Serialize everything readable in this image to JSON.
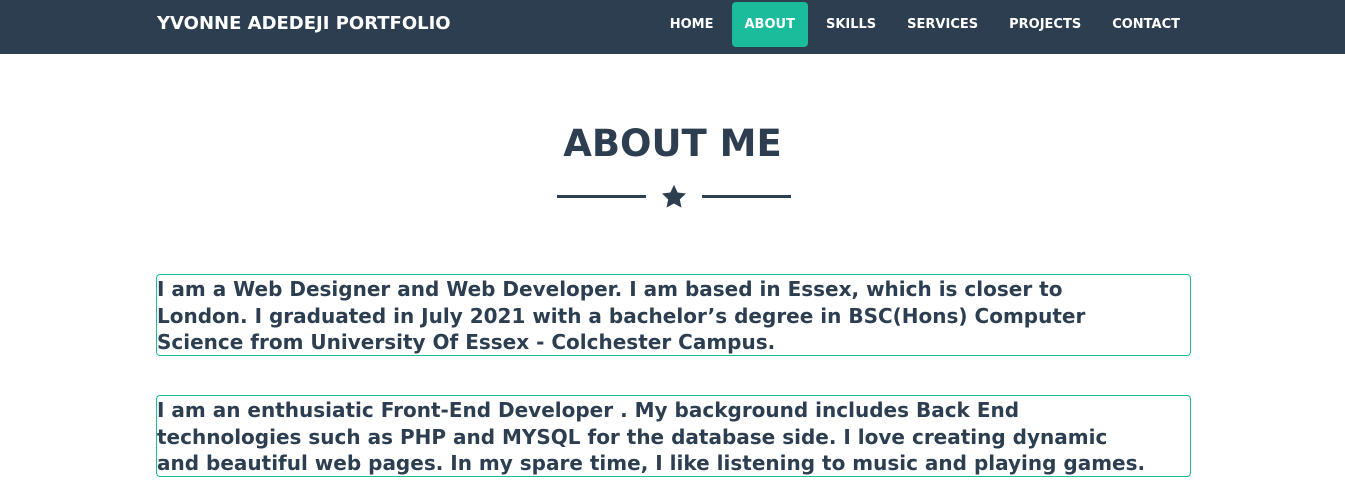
{
  "header": {
    "brand": "YVONNE ADEDEJI PORTFOLIO",
    "nav": [
      {
        "label": "HOME"
      },
      {
        "label": "ABOUT"
      },
      {
        "label": "SKILLS"
      },
      {
        "label": "SERVICES"
      },
      {
        "label": "PROJECTS"
      },
      {
        "label": "CONTACT"
      }
    ],
    "active_nav": "ABOUT"
  },
  "about": {
    "title": "ABOUT ME",
    "divider_icon": "star-icon",
    "paragraphs": [
      {
        "lines": [
          "I am a Web Designer and Web Developer. I am based in Essex, which is closer to",
          "London. I graduated in July 2021 with a bachelor’s degree in BSC(Hons) Computer",
          "Science from University Of Essex - Colchester Campus."
        ]
      },
      {
        "lines": [
          "I am an enthusiatic Front-End Developer . My background includes Back End",
          "technologies such as PHP and MYSQL for the database side. I love creating dynamic",
          "and beautiful web pages. In my spare time, I like listening to music and playing games."
        ]
      }
    ]
  },
  "colors": {
    "navbar": "#2c3e50",
    "accent": "#1abc9c",
    "text": "#2c3e50"
  }
}
